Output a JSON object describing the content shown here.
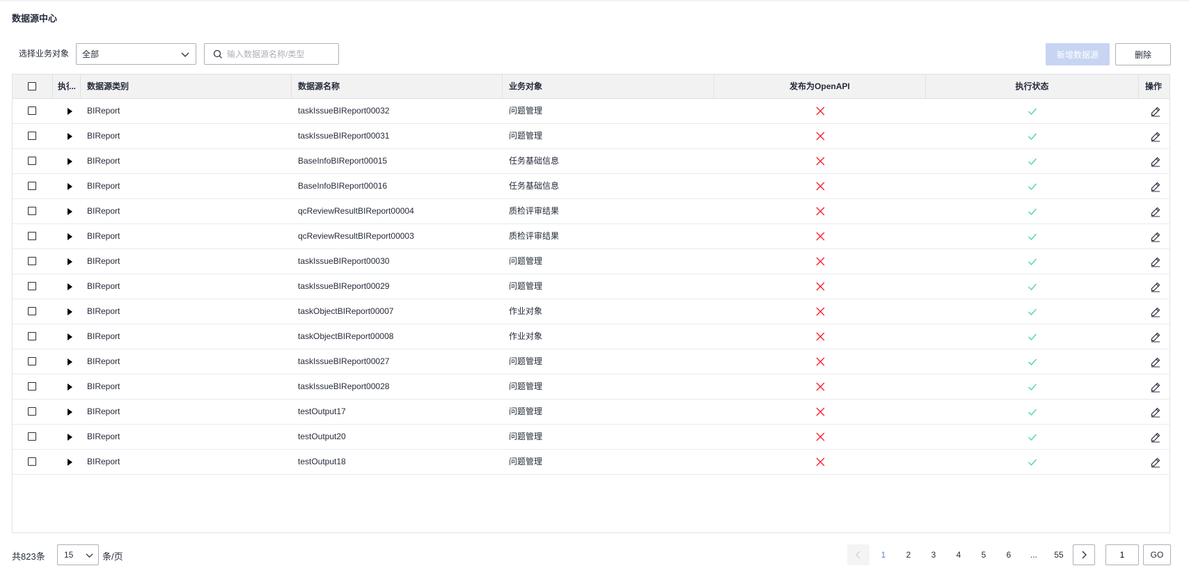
{
  "page": {
    "title": "数据源中心"
  },
  "filter": {
    "label": "选择业务对象",
    "select_value": "全部",
    "search_placeholder": "输入数据源名称/类型"
  },
  "toolbar": {
    "new_label": "新增数据源",
    "delete_label": "删除"
  },
  "table": {
    "headers": {
      "exec": "执行",
      "category": "数据源类别",
      "name": "数据源名称",
      "object": "业务对象",
      "openapi": "发布为OpenAPI",
      "status": "执行状态",
      "actions": "操作"
    },
    "rows": [
      {
        "category": "BIReport",
        "name": "taskIssueBIReport00032",
        "object": "问题管理",
        "openapi": false,
        "status": true
      },
      {
        "category": "BIReport",
        "name": "taskIssueBIReport00031",
        "object": "问题管理",
        "openapi": false,
        "status": true
      },
      {
        "category": "BIReport",
        "name": "BaseInfoBIReport00015",
        "object": "任务基础信息",
        "openapi": false,
        "status": true
      },
      {
        "category": "BIReport",
        "name": "BaseInfoBIReport00016",
        "object": "任务基础信息",
        "openapi": false,
        "status": true
      },
      {
        "category": "BIReport",
        "name": "qcReviewResultBIReport00004",
        "object": "质检评审结果",
        "openapi": false,
        "status": true
      },
      {
        "category": "BIReport",
        "name": "qcReviewResultBIReport00003",
        "object": "质检评审结果",
        "openapi": false,
        "status": true
      },
      {
        "category": "BIReport",
        "name": "taskIssueBIReport00030",
        "object": "问题管理",
        "openapi": false,
        "status": true
      },
      {
        "category": "BIReport",
        "name": "taskIssueBIReport00029",
        "object": "问题管理",
        "openapi": false,
        "status": true
      },
      {
        "category": "BIReport",
        "name": "taskObjectBIReport00007",
        "object": "作业对象",
        "openapi": false,
        "status": true
      },
      {
        "category": "BIReport",
        "name": "taskObjectBIReport00008",
        "object": "作业对象",
        "openapi": false,
        "status": true
      },
      {
        "category": "BIReport",
        "name": "taskIssueBIReport00027",
        "object": "问题管理",
        "openapi": false,
        "status": true
      },
      {
        "category": "BIReport",
        "name": "taskIssueBIReport00028",
        "object": "问题管理",
        "openapi": false,
        "status": true
      },
      {
        "category": "BIReport",
        "name": "testOutput17",
        "object": "问题管理",
        "openapi": false,
        "status": true
      },
      {
        "category": "BIReport",
        "name": "testOutput20",
        "object": "问题管理",
        "openapi": false,
        "status": true
      },
      {
        "category": "BIReport",
        "name": "testOutput18",
        "object": "问题管理",
        "openapi": false,
        "status": true
      }
    ]
  },
  "pagination": {
    "total_label": "共823条",
    "page_size": "15",
    "per_page_label": "条/页",
    "pages": [
      "1",
      "2",
      "3",
      "4",
      "5",
      "6",
      "...",
      "55"
    ],
    "current_page": "1",
    "jump_value": "1",
    "go_label": "GO"
  },
  "colors": {
    "accent": "#5e7ce0",
    "error": "#f5222d",
    "success": "#50d4ab"
  },
  "icons": {
    "select_arrow": "chevron-down-icon",
    "search": "search-icon",
    "expand": "caret-right-icon",
    "openapi_off": "close-icon",
    "status_ok": "check-icon",
    "edit": "edit-icon",
    "prev": "chevron-left-icon",
    "next": "chevron-right-icon"
  }
}
